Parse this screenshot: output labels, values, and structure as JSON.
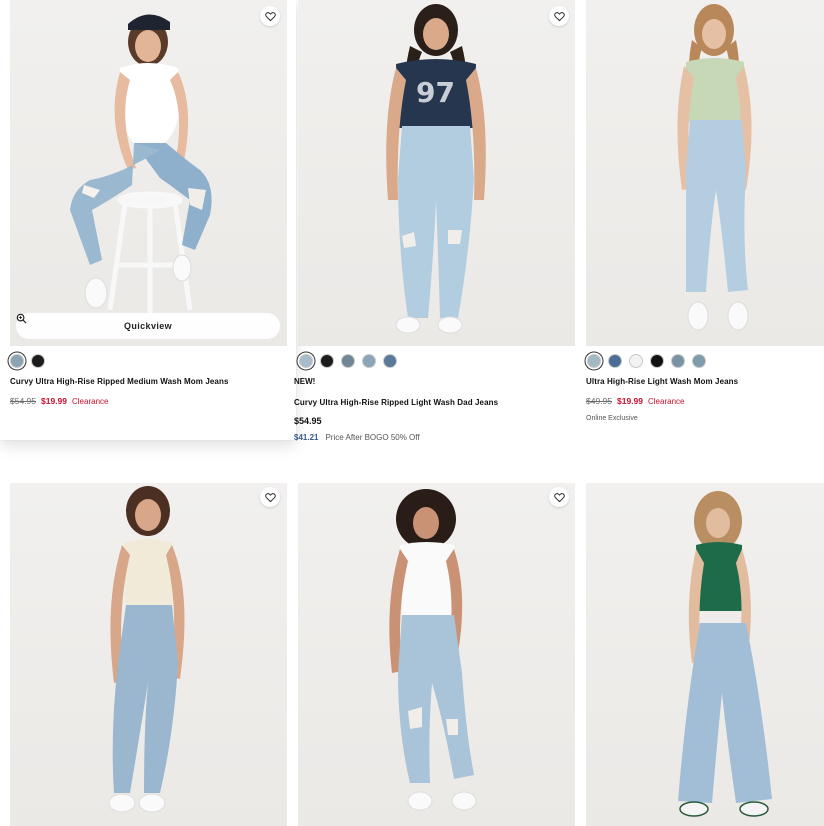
{
  "quickview_label": "Quickview",
  "products": [
    {
      "id": "p1",
      "name": "Curvy Ultra High-Rise Ripped Medium Wash Mom Jeans",
      "badge": "",
      "original_price": "$54.95",
      "sale_price": "$19.99",
      "sale_tag": "Clearance",
      "swatches": [
        "#8aa4b3",
        "#1c1c1c"
      ],
      "selected_swatch": 0
    },
    {
      "id": "p2",
      "name": "Curvy Ultra High-Rise Ripped Light Wash Dad Jeans",
      "badge": "NEW!",
      "price": "$54.95",
      "promo_price": "$41.21",
      "promo_text": "Price After BOGO 50% Off",
      "swatches": [
        "#a7bccb",
        "#1c1c1c",
        "#6f8794",
        "#8aa6b8",
        "#587a99"
      ],
      "selected_swatch": 0
    },
    {
      "id": "p3",
      "name": "Ultra High-Rise Light Wash Mom Jeans",
      "badge": "",
      "original_price": "$49.95",
      "sale_price": "$19.99",
      "sale_tag": "Clearance",
      "note": "Online Exclusive",
      "swatches": [
        "#a2b8c4",
        "#4b6d97",
        "#f2f2f2",
        "#111111",
        "#7894a3",
        "#7f9aac"
      ],
      "selected_swatch": 0
    },
    {
      "id": "p4"
    },
    {
      "id": "p5"
    },
    {
      "id": "p6"
    }
  ],
  "colors": {
    "sale_red": "#c8102e",
    "promo_blue": "#3a5a8a",
    "denim_light": "#a9c3d9",
    "denim_mid": "#8fb0cc"
  }
}
